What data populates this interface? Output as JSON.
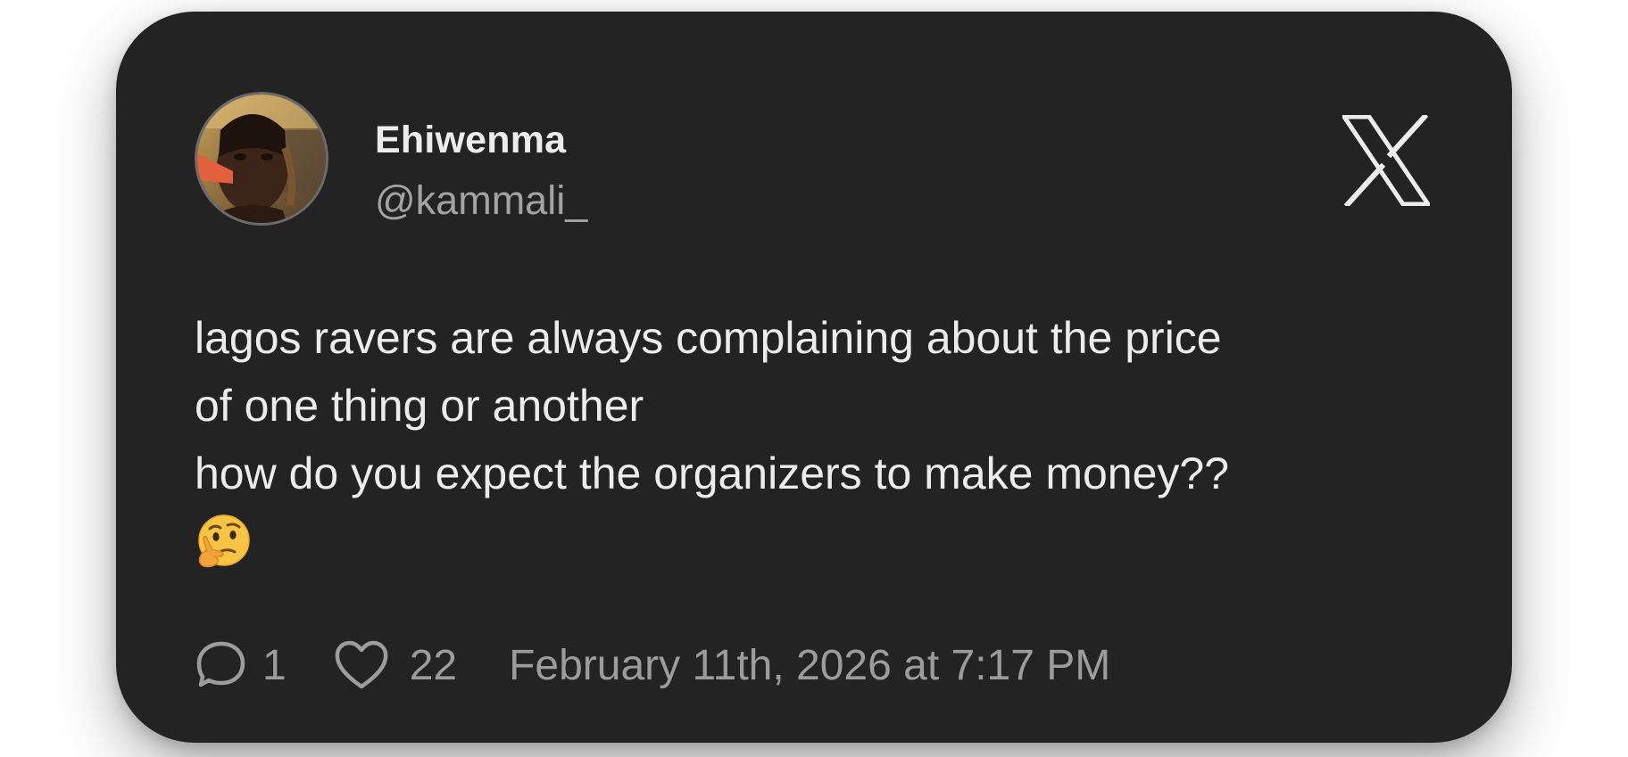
{
  "author": {
    "name": "Ehiwenma",
    "handle": "@kammali_",
    "avatar_icon": "profile-photo"
  },
  "platform": {
    "logo_icon": "x-logo"
  },
  "tweet": {
    "lines": [
      "lagos ravers are always complaining about the price",
      "of one thing or another",
      "how do you expect the organizers to make money??"
    ],
    "emoji_icon": "thinking-face-emoji"
  },
  "stats": {
    "reply_icon": "speech-bubble-icon",
    "replies": "1",
    "like_icon": "heart-icon",
    "likes": "22",
    "timestamp": "February 11th, 2026 at 7:17 PM"
  },
  "colors": {
    "card_background": "#232323",
    "primary_text": "#ececec",
    "secondary_text": "#a3a3a3",
    "page_background": "#ffffff"
  }
}
